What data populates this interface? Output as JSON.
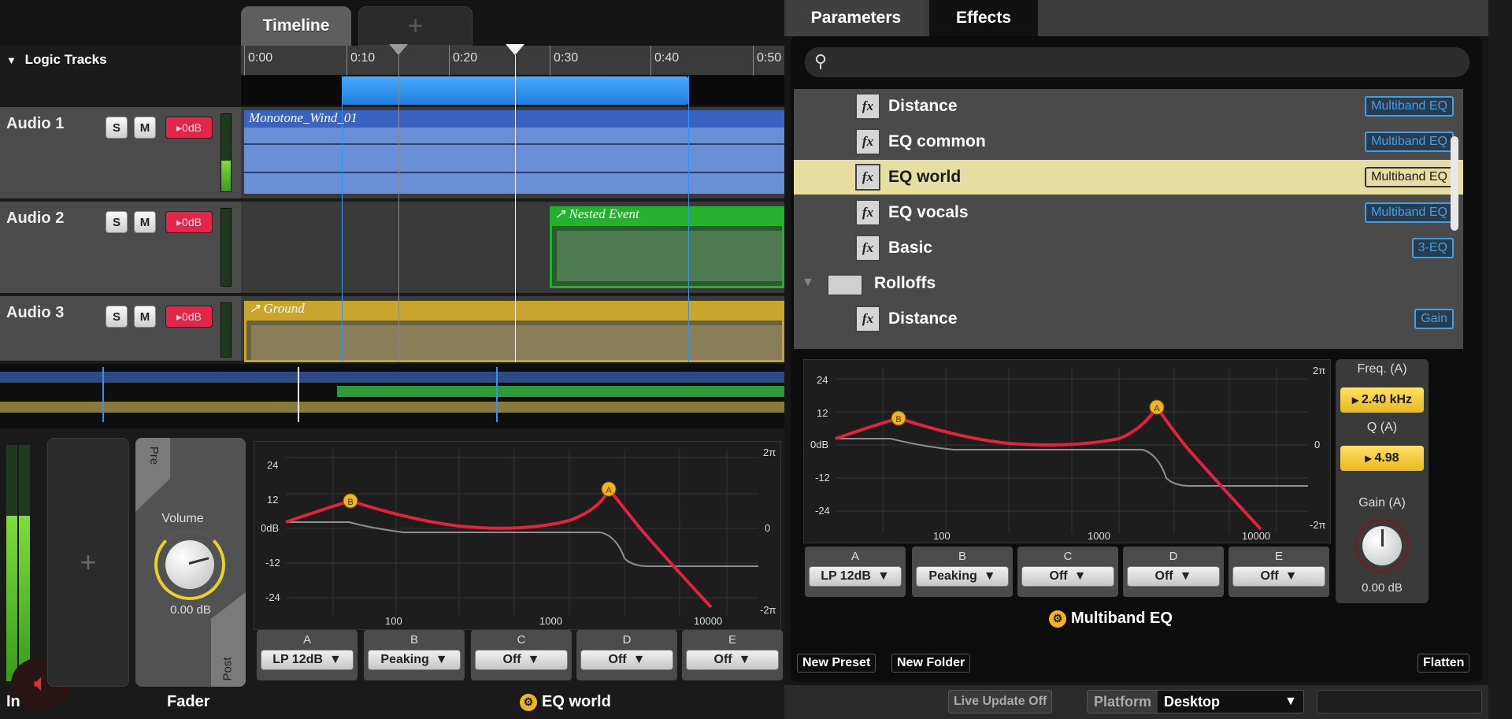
{
  "timeline": {
    "tab_label": "Timeline",
    "add_tab_label": "+",
    "logic_tracks_label": "Logic Tracks",
    "ruler_ticks": [
      "0:00",
      "0:10",
      "0:20",
      "0:30",
      "0:40",
      "0:50"
    ]
  },
  "tracks": [
    {
      "name": "Audio 1",
      "solo": "S",
      "mute": "M",
      "volume": "0dB",
      "event": "Monotone_Wind_01"
    },
    {
      "name": "Audio 2",
      "solo": "S",
      "mute": "M",
      "volume": "0dB",
      "event": "Nested Event"
    },
    {
      "name": "Audio 3",
      "solo": "S",
      "mute": "M",
      "volume": "0dB",
      "event": "Ground"
    }
  ],
  "deck": {
    "input_label": "In",
    "add_label": "+",
    "pre_label": "Pre",
    "post_label": "Post",
    "volume_label": "Volume",
    "volume_value": "0.00 dB",
    "fader_label": "Fader",
    "effect_title": "EQ world"
  },
  "eq_left": {
    "y_ticks": [
      "24",
      "12",
      "0dB",
      "-12",
      "-24"
    ],
    "x_ticks": [
      "100",
      "1000",
      "10000"
    ],
    "right_ticks": [
      "2π",
      "0",
      "-2π"
    ],
    "bands": [
      {
        "letter": "A",
        "value": "LP 12dB"
      },
      {
        "letter": "B",
        "value": "Peaking"
      },
      {
        "letter": "C",
        "value": "Off"
      },
      {
        "letter": "D",
        "value": "Off"
      },
      {
        "letter": "E",
        "value": "Off"
      }
    ]
  },
  "right_panel": {
    "tabs": [
      "Parameters",
      "Effects"
    ],
    "search_placeholder": "",
    "list": [
      {
        "label": "Distance",
        "badge": "Multiband EQ",
        "type": "preset",
        "selected": false
      },
      {
        "label": "EQ common",
        "badge": "Multiband EQ",
        "type": "preset",
        "selected": false
      },
      {
        "label": "EQ world",
        "badge": "Multiband EQ",
        "type": "preset",
        "selected": true
      },
      {
        "label": "EQ vocals",
        "badge": "Multiband EQ",
        "type": "preset",
        "selected": false
      },
      {
        "label": "Basic",
        "badge": "3-EQ",
        "type": "preset",
        "selected": false
      },
      {
        "label": "Rolloffs",
        "badge": "",
        "type": "folder",
        "selected": false
      },
      {
        "label": "Distance",
        "badge": "Gain",
        "type": "preset",
        "selected": false
      }
    ],
    "eq": {
      "y_ticks": [
        "24",
        "12",
        "0dB",
        "-12",
        "-24"
      ],
      "x_ticks": [
        "100",
        "1000",
        "10000"
      ],
      "right_ticks": [
        "2π",
        "0",
        "-2π"
      ],
      "freq_label": "Freq. (A)",
      "freq_value": "2.40 kHz",
      "q_label": "Q (A)",
      "q_value": "4.98",
      "gain_label": "Gain (A)",
      "gain_value": "0.00 dB",
      "bands": [
        {
          "letter": "A",
          "value": "LP 12dB"
        },
        {
          "letter": "B",
          "value": "Peaking"
        },
        {
          "letter": "C",
          "value": "Off"
        },
        {
          "letter": "D",
          "value": "Off"
        },
        {
          "letter": "E",
          "value": "Off"
        }
      ],
      "title": "Multiband EQ"
    },
    "new_preset": "New Preset",
    "new_folder": "New Folder",
    "flatten": "Flatten",
    "live_update": "Live Update Off",
    "platform_label": "Platform",
    "platform_value": "Desktop"
  },
  "colors": {
    "accent": "#f2b520",
    "eq_curve": "#e0243f",
    "loop": "#2d93f5",
    "badge": "#3fa0ea",
    "selected_row": "#e6dda0"
  }
}
